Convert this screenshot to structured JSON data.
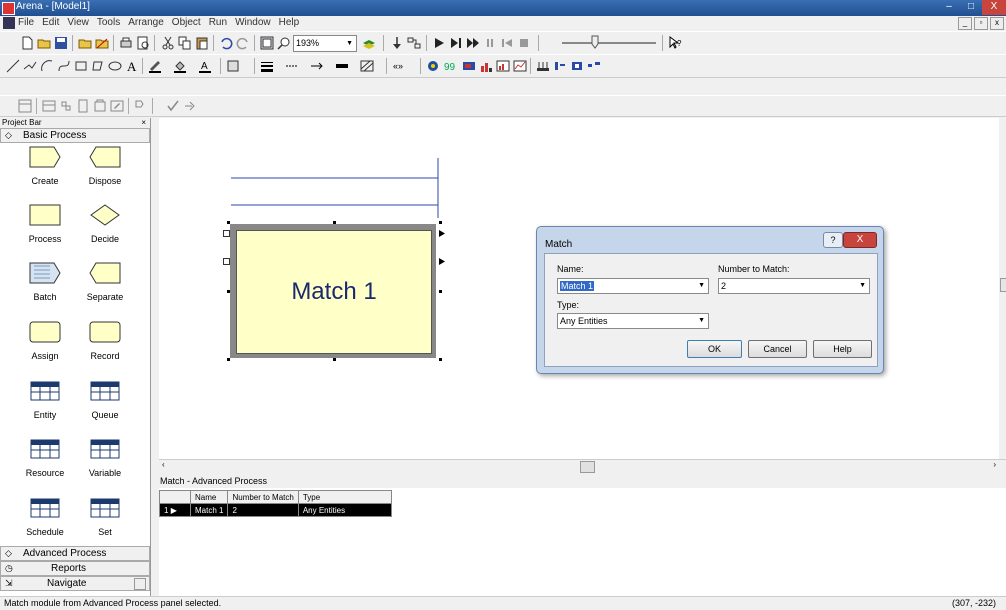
{
  "window": {
    "title": "Arena - [Model1]",
    "minimize": "–",
    "maximize": "□",
    "close": "X"
  },
  "menu": {
    "items": [
      "File",
      "Edit",
      "View",
      "Tools",
      "Arrange",
      "Object",
      "Run",
      "Window",
      "Help"
    ]
  },
  "toolbar": {
    "zoom": "193%"
  },
  "project_bar": {
    "title": "Project Bar",
    "close": "×",
    "basic_panel": "Basic Process",
    "modules": [
      "Create",
      "Dispose",
      "Process",
      "Decide",
      "Batch",
      "Separate",
      "Assign",
      "Record",
      "Entity",
      "Queue",
      "Resource",
      "Variable",
      "Schedule",
      "Set"
    ],
    "advanced_panel": "Advanced Process",
    "reports_panel": "Reports",
    "navigate_panel": "Navigate"
  },
  "canvas": {
    "module_label": "Match 1"
  },
  "dialog": {
    "title": "Match",
    "help_glyph": "?",
    "close_glyph": "X",
    "name_label": "Name:",
    "name_value": "Match 1",
    "number_label": "Number to Match:",
    "number_value": "2",
    "type_label": "Type:",
    "type_value": "Any Entities",
    "ok": "OK",
    "cancel": "Cancel",
    "help": "Help"
  },
  "spreadsheet": {
    "title": "Match - Advanced Process",
    "headers": [
      "Name",
      "Number to Match",
      "Type"
    ],
    "row": {
      "index": "1",
      "name": "Match 1",
      "number": "2",
      "type": "Any Entities"
    }
  },
  "status": {
    "message": "Match module from Advanced Process panel selected.",
    "coords": "(307, -232)"
  }
}
